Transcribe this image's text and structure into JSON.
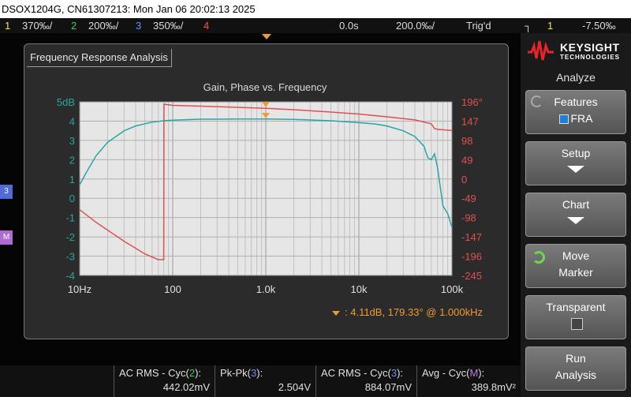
{
  "titlebar": {
    "text": "DSOX1204G, CN61307213: Mon Jan 06 20:02:13 2025"
  },
  "status": {
    "ch1_num": "1",
    "ch1_scale": "370‰/",
    "ch2_num": "2",
    "ch2_scale": "200‰/",
    "ch3_num": "3",
    "ch3_scale": "350‰/",
    "ch4_num": "4",
    "time_delay": "0.0s",
    "time_scale": "200.0‰/",
    "trigger": "Trig'd",
    "trig_source": "1",
    "trig_level": "-7.50‰"
  },
  "markers": {
    "ch3": "3",
    "math": "M"
  },
  "fra": {
    "window_title": "Frequency Response Analysis",
    "marker_readout": ":  4.11dB, 179.33° @ 1.000kHz"
  },
  "chart_data": {
    "type": "line",
    "title": "Gain, Phase vs. Frequency",
    "xscale": "log",
    "xlim": [
      10,
      100000
    ],
    "x_tick_labels": [
      "10Hz",
      "100",
      "1.0k",
      "10k",
      "100k"
    ],
    "y_left_unit": "dB",
    "y_left_lim": [
      -4,
      5
    ],
    "y_left_tick_labels": [
      "5dB",
      "4",
      "3",
      "2",
      "1",
      "0",
      "-1",
      "-2",
      "-3",
      "-4"
    ],
    "y_right_lim": [
      -245,
      196
    ],
    "y_right_tick_labels": [
      "196°",
      "147",
      "98",
      "49",
      "0",
      "-49",
      "-98",
      "-147",
      "-196",
      "-245"
    ],
    "grid": true,
    "series": [
      {
        "axis": "left",
        "color": "#27a6a6",
        "x": [
          10,
          12,
          15,
          20,
          30,
          40,
          60,
          80,
          100,
          150,
          200,
          300,
          500,
          1000,
          2000,
          5000,
          10000,
          15000,
          20000,
          30000,
          40000,
          50000,
          55000,
          60000,
          65000,
          70000,
          80000,
          90000,
          100000
        ],
        "y": [
          0.7,
          1.4,
          2.2,
          2.9,
          3.5,
          3.75,
          3.95,
          4.02,
          4.05,
          4.08,
          4.1,
          4.1,
          4.11,
          4.11,
          4.09,
          4.02,
          3.92,
          3.85,
          3.75,
          3.5,
          3.2,
          2.7,
          2.1,
          2.0,
          2.3,
          1.6,
          -0.4,
          -0.8,
          -1.5
        ]
      },
      {
        "axis": "right",
        "color": "#e05050",
        "x": [
          10,
          15,
          20,
          30,
          50,
          70,
          80,
          80.5,
          100,
          200,
          500,
          1000,
          2000,
          5000,
          10000,
          20000,
          40000,
          60000,
          65000,
          70000,
          80000,
          100000
        ],
        "y": [
          -78,
          -110,
          -130,
          -158,
          -190,
          -205,
          -205,
          190,
          187,
          185,
          182,
          179.33,
          176,
          170,
          165,
          158,
          150,
          140,
          128,
          126,
          125,
          123
        ]
      }
    ]
  },
  "sidebar": {
    "brand_line1": "KEYSIGHT",
    "brand_line2": "TECHNOLOGIES",
    "heading": "Analyze",
    "features_label": "Features",
    "features_value": "FRA",
    "setup_label": "Setup",
    "chart_label": "Chart",
    "move_label1": "Move",
    "move_label2": "Marker",
    "transparent_label": "Transparent",
    "run_label1": "Run",
    "run_label2": "Analysis"
  },
  "measurements": [
    {
      "name_pre": "AC RMS - Cyc(",
      "src": "2",
      "name_post": "):",
      "value": "442.02mV",
      "src_color": "#3ad14a"
    },
    {
      "name_pre": "Pk-Pk(",
      "src": "3",
      "name_post": "):",
      "value": "2.504V",
      "src_color": "#6a8cff"
    },
    {
      "name_pre": "AC RMS - Cyc(",
      "src": "3",
      "name_post": "):",
      "value": "884.07mV",
      "src_color": "#6a8cff"
    },
    {
      "name_pre": "Avg - Cyc(",
      "src": "M",
      "name_post": "):",
      "value": "389.8mV²",
      "src_color": "#c07ae0"
    }
  ]
}
